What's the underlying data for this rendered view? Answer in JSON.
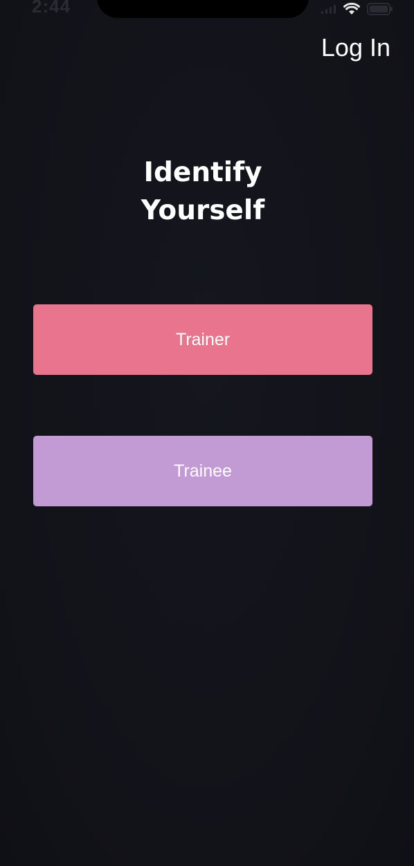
{
  "status_bar": {
    "time": "2:44",
    "icons": [
      "signal-icon",
      "wifi-icon",
      "battery-icon"
    ]
  },
  "header": {
    "login_label": "Log In"
  },
  "main": {
    "title_line1": "Identify",
    "title_line2": "Yourself",
    "trainer_label": "Trainer",
    "trainee_label": "Trainee"
  },
  "colors": {
    "background": "#121319",
    "trainer_button": "#e8758d",
    "trainee_button": "#c29bd4",
    "text": "#ffffff"
  }
}
